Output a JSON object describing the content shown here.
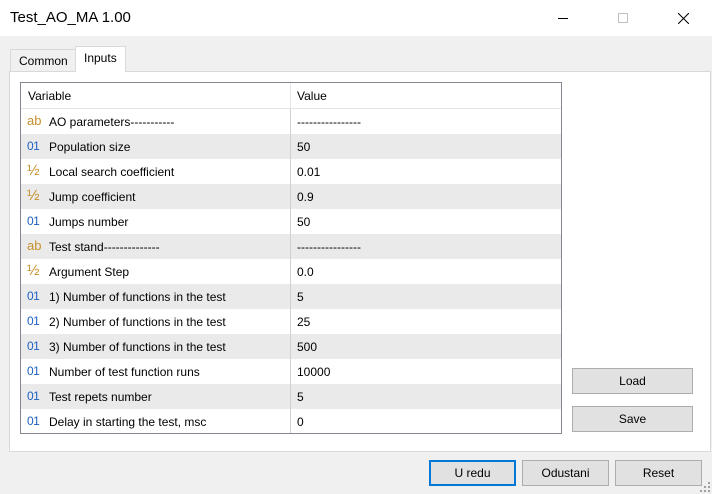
{
  "window": {
    "title": "Test_AO_MA 1.00"
  },
  "tabs": [
    {
      "label": "Common"
    },
    {
      "label": "Inputs"
    }
  ],
  "grid": {
    "headers": {
      "variable": "Variable",
      "value": "Value"
    },
    "rows": [
      {
        "icon": "ab",
        "variable": "AO parameters-----------",
        "value": "----------------"
      },
      {
        "icon": "01",
        "variable": "Population size",
        "value": "50"
      },
      {
        "icon": "½",
        "variable": "Local search coefficient",
        "value": "0.01"
      },
      {
        "icon": "½",
        "variable": "Jump coefficient",
        "value": "0.9"
      },
      {
        "icon": "01",
        "variable": "Jumps number",
        "value": "50"
      },
      {
        "icon": "ab",
        "variable": "Test stand--------------",
        "value": "----------------"
      },
      {
        "icon": "½",
        "variable": "Argument Step",
        "value": "0.0"
      },
      {
        "icon": "01",
        "variable": "1) Number of functions in the test",
        "value": "5"
      },
      {
        "icon": "01",
        "variable": "2) Number of functions in the test",
        "value": "25"
      },
      {
        "icon": "01",
        "variable": "3) Number of functions in the test",
        "value": "500"
      },
      {
        "icon": "01",
        "variable": "Number of test function runs",
        "value": "10000"
      },
      {
        "icon": "01",
        "variable": "Test repets number",
        "value": "5"
      },
      {
        "icon": "01",
        "variable": "Delay in starting the test, msc",
        "value": "0"
      }
    ]
  },
  "side_buttons": {
    "load": "Load",
    "save": "Save"
  },
  "footer_buttons": {
    "ok": "U redu",
    "cancel": "Odustani",
    "reset": "Reset"
  }
}
